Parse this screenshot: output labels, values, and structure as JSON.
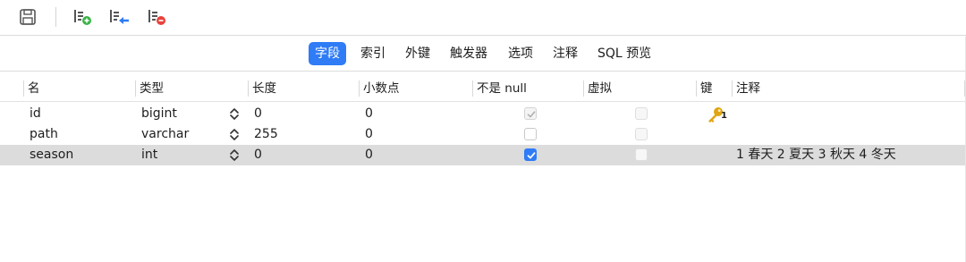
{
  "toolbar": {
    "buttons": [
      {
        "icon": "save-icon"
      },
      {
        "icon": "add-field-icon"
      },
      {
        "icon": "insert-field-icon"
      },
      {
        "icon": "delete-field-icon"
      }
    ]
  },
  "tabs": [
    {
      "label": "字段",
      "active": true
    },
    {
      "label": "索引",
      "active": false
    },
    {
      "label": "外键",
      "active": false
    },
    {
      "label": "触发器",
      "active": false
    },
    {
      "label": "选项",
      "active": false
    },
    {
      "label": "注释",
      "active": false
    },
    {
      "label": "SQL 预览",
      "active": false
    }
  ],
  "columns": {
    "name": "名",
    "type": "类型",
    "length": "长度",
    "decimals": "小数点",
    "not_null": "不是 null",
    "virtual": "虚拟",
    "key": "键",
    "comment": "注释"
  },
  "rows": [
    {
      "name": "id",
      "type": "bigint",
      "length": "0",
      "decimals": "0",
      "not_null": "checked-disabled",
      "virtual": false,
      "key": "1",
      "comment": "",
      "selected": false
    },
    {
      "name": "path",
      "type": "varchar",
      "length": "255",
      "decimals": "0",
      "not_null": "unchecked",
      "virtual": false,
      "key": "",
      "comment": "",
      "selected": false
    },
    {
      "name": "season",
      "type": "int",
      "length": "0",
      "decimals": "0",
      "not_null": "checked",
      "virtual": false,
      "key": "",
      "comment": "1 春天 2 夏天 3 秋天 4 冬天",
      "selected": true
    }
  ],
  "colors": {
    "accent": "#2f7cf6",
    "selected_row": "#dcdcdc",
    "key_gold": "#e0a514"
  }
}
